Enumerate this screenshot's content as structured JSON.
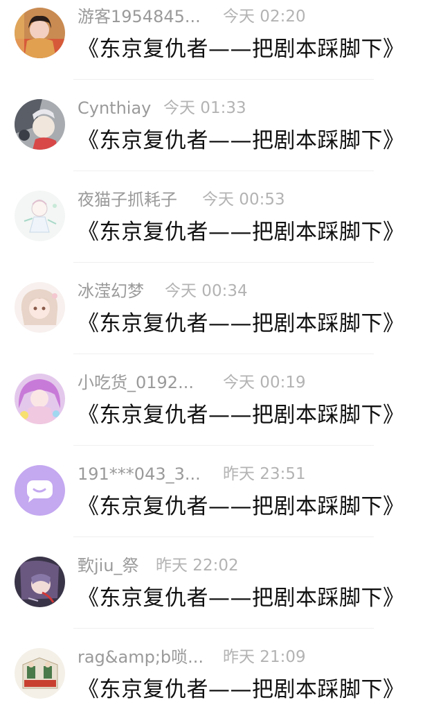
{
  "messages": [
    {
      "username": "游客1954845...",
      "time": "今天 02:20",
      "text": "《东京复仇者——把剧本踩脚下》",
      "avatar": "avatar-photo-girl"
    },
    {
      "username": "Cynthiay",
      "time": "今天 01:33",
      "text": "《东京复仇者——把剧本踩脚下》",
      "avatar": "avatar-anime-grey"
    },
    {
      "username": "夜猫子抓耗子",
      "time": "今天 00:53",
      "text": "《东京复仇者——把剧本踩脚下》",
      "avatar": "avatar-anime-sketch"
    },
    {
      "username": "冰滢幻梦",
      "time": "今天 00:34",
      "text": "《东京复仇者——把剧本踩脚下》",
      "avatar": "avatar-anime-pink-hair"
    },
    {
      "username": "小吃货_0192...",
      "time": "今天 00:19",
      "text": "《东京复仇者——把剧本踩脚下》",
      "avatar": "avatar-anime-purple"
    },
    {
      "username": "191***043_3...",
      "time": "昨天 23:51",
      "text": "《东京复仇者——把剧本踩脚下》",
      "avatar": "default-chat-bubble-icon"
    },
    {
      "username": "歅jiu_祭",
      "time": "昨天 22:02",
      "text": "《东京复仇者——把剧本踩脚下》",
      "avatar": "avatar-anime-dark"
    },
    {
      "username": "rag&amp;b唢...",
      "time": "昨天 21:09",
      "text": "《东京复仇者——把剧本踩脚下》",
      "avatar": "avatar-figurine-box"
    }
  ],
  "colors": {
    "username": "#9a9a9a",
    "time": "#b3b3b3",
    "message": "#111111",
    "divider": "#efefef",
    "default_avatar": "#c4a8f0"
  }
}
